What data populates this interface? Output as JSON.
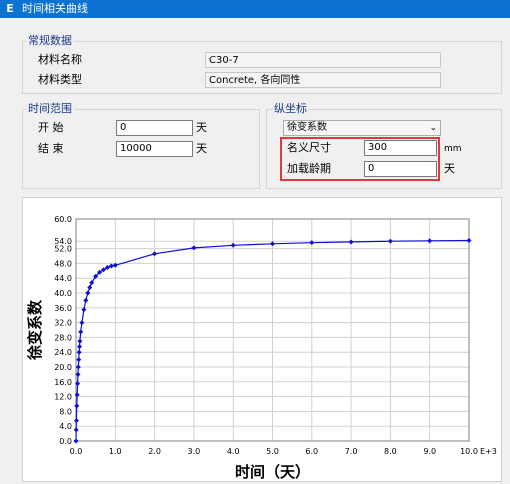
{
  "window": {
    "icon_letter": "E",
    "title": "时间相关曲线"
  },
  "general": {
    "group_label": "常规数据",
    "material_name_label": "材料名称",
    "material_name_value": "C30-7",
    "material_type_label": "材料类型",
    "material_type_value": "Concrete, 各向同性"
  },
  "time_range": {
    "group_label": "时间范围",
    "start_label": "开 始",
    "start_value": "0",
    "start_unit": "天",
    "end_label": "结 束",
    "end_value": "10000",
    "end_unit": "天"
  },
  "ordinate": {
    "group_label": "纵坐标",
    "selected": "徐变系数",
    "nominal_size_label": "名义尺寸",
    "nominal_size_value": "300",
    "nominal_size_unit": "mm",
    "loading_age_label": "加载龄期",
    "loading_age_value": "0",
    "loading_age_unit": "天"
  },
  "colors": {
    "series": "#1010d0",
    "highlight": "#e0393b",
    "titlebar": "#0c73d2"
  },
  "chart_data": {
    "type": "line",
    "xlabel": "时间（天）",
    "ylabel": "徐变系数",
    "x_multiplier_label": "E+3",
    "xlim": [
      0,
      10
    ],
    "ylim": [
      0,
      60
    ],
    "x_ticks": [
      "0.0",
      "1.0",
      "2.0",
      "3.0",
      "4.0",
      "5.0",
      "6.0",
      "7.0",
      "8.0",
      "9.0",
      "10.0"
    ],
    "y_ticks": [
      "0.0",
      "4.0",
      "8.0",
      "12.0",
      "16.0",
      "20.0",
      "24.0",
      "28.0",
      "32.0",
      "36.0",
      "40.0",
      "44.0",
      "48.0",
      "52.0",
      "54.0",
      "60.0"
    ],
    "grid": true,
    "series": [
      {
        "x": [
          0,
          0.005,
          0.01,
          0.02,
          0.03,
          0.04,
          0.05,
          0.06,
          0.07,
          0.08,
          0.09,
          0.1,
          0.12,
          0.15,
          0.2,
          0.25,
          0.3,
          0.35,
          0.4,
          0.5,
          0.6,
          0.7,
          0.8,
          0.9,
          1.0,
          2.0,
          3.0,
          4.0,
          5.0,
          6.0,
          7.0,
          8.0,
          9.0,
          10.0
        ],
        "y": [
          0,
          3.0,
          5.5,
          9.5,
          12.5,
          15.5,
          18.0,
          20.0,
          22.0,
          24.0,
          25.5,
          27.0,
          29.5,
          32.0,
          35.5,
          38.0,
          40.0,
          41.5,
          42.8,
          44.5,
          45.6,
          46.3,
          46.9,
          47.3,
          47.5,
          50.6,
          52.2,
          52.9,
          53.3,
          53.6,
          53.8,
          54.0,
          54.1,
          54.2
        ]
      }
    ]
  }
}
